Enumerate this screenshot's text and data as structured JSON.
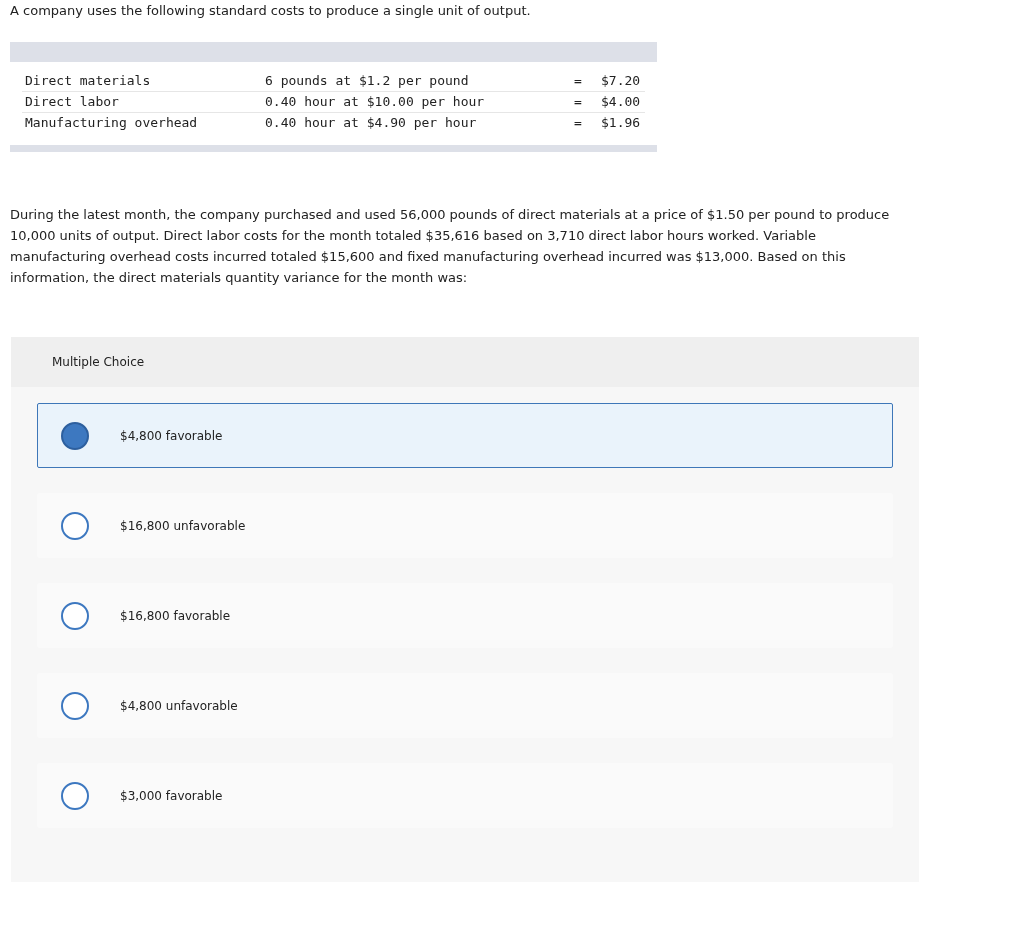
{
  "question_intro": "A company uses the following standard costs to produce a single unit of output.",
  "cost_table": {
    "rows": [
      {
        "item": "Direct materials",
        "basis": "6 pounds at $1.2 per pound",
        "equals": "=",
        "amount": "$7.20"
      },
      {
        "item": "Direct labor",
        "basis": "0.40 hour at $10.00 per hour",
        "equals": "=",
        "amount": "$4.00"
      },
      {
        "item": "Manufacturing overhead",
        "basis": "0.40 hour at $4.90 per hour",
        "equals": "=",
        "amount": "$1.96"
      }
    ]
  },
  "question_text": "During the latest month, the company purchased and used 56,000 pounds of direct materials at a price of $1.50 per pound to produce 10,000 units of output. Direct labor costs for the month totaled $35,616 based on 3,710 direct labor hours worked. Variable manufacturing overhead costs incurred totaled $15,600 and fixed manufacturing overhead incurred was $13,000. Based on this information, the direct materials quantity variance for the month was:",
  "multiple_choice": {
    "heading": "Multiple Choice",
    "options": [
      {
        "label": "$4,800 favorable",
        "selected": true
      },
      {
        "label": "$16,800 unfavorable",
        "selected": false
      },
      {
        "label": "$16,800 favorable",
        "selected": false
      },
      {
        "label": "$4,800 unfavorable",
        "selected": false
      },
      {
        "label": "$3,000 favorable",
        "selected": false
      }
    ]
  }
}
